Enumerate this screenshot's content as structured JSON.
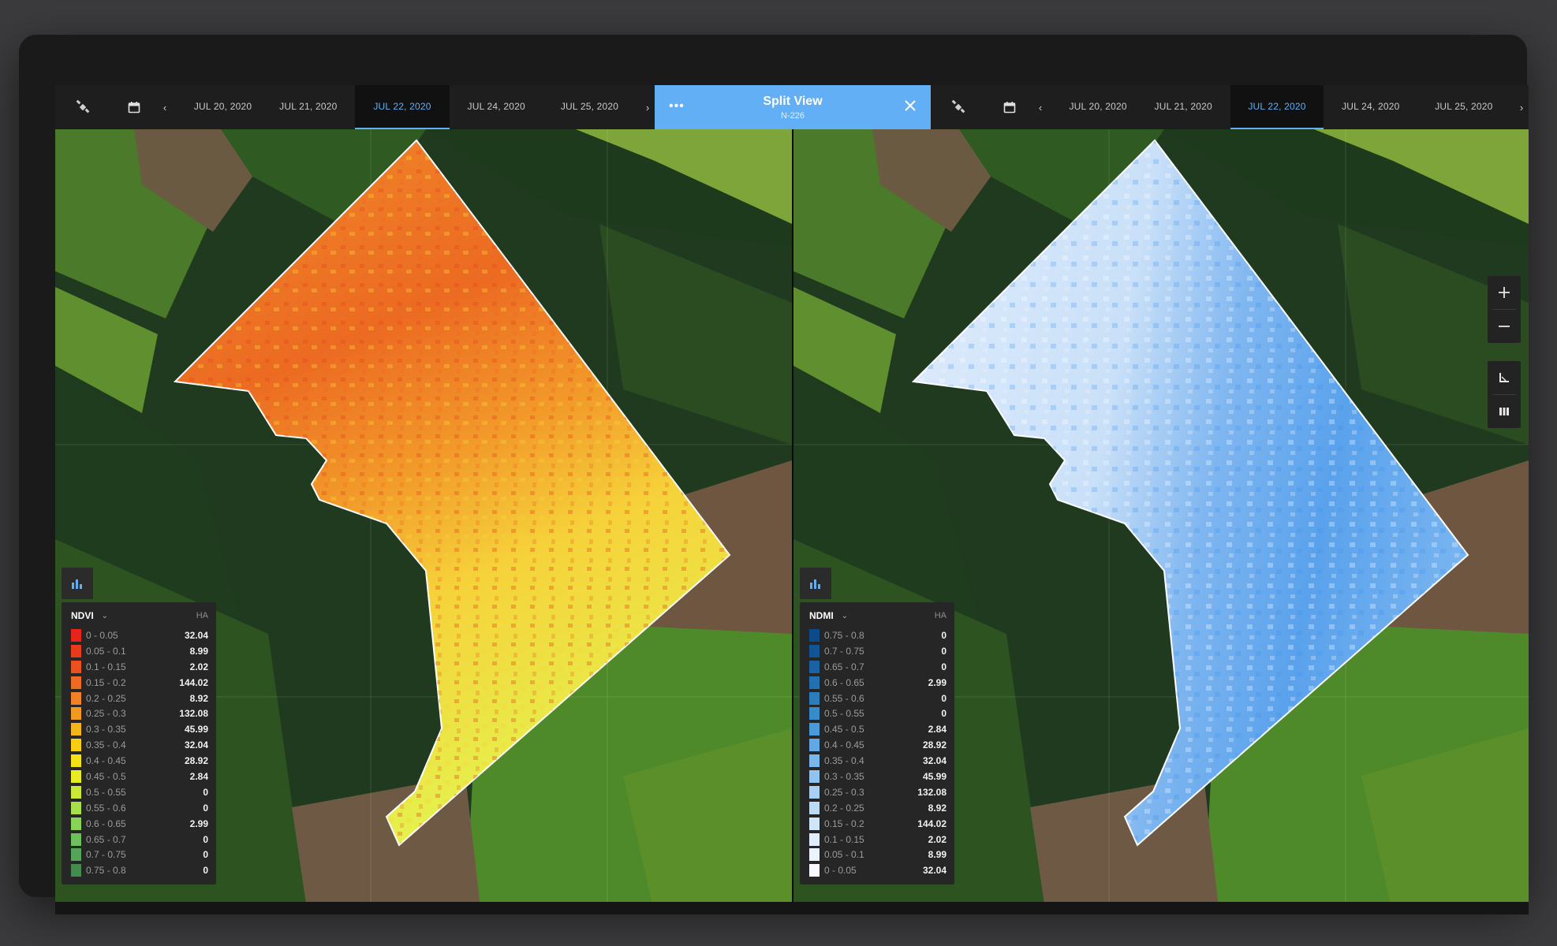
{
  "left_bar": {
    "icon": "satellite-icon",
    "calendar_icon": "calendar-icon",
    "dates": [
      {
        "label": "JUL 20, 2020",
        "active": false
      },
      {
        "label": "JUL 21, 2020",
        "active": false
      },
      {
        "label": "JUL 22, 2020",
        "active": true
      },
      {
        "label": "JUL 24, 2020",
        "active": false
      },
      {
        "label": "JUL 25, 2020",
        "active": false
      }
    ]
  },
  "split_view": {
    "menu_icon": "more-dots-icon",
    "title": "Split View",
    "subtitle": "N-226",
    "close_icon": "close-icon"
  },
  "right_bar": {
    "icon": "satellite-icon",
    "calendar_icon": "calendar-icon",
    "dates": [
      {
        "label": "JUL 20, 2020",
        "active": false
      },
      {
        "label": "JUL 21, 2020",
        "active": false
      },
      {
        "label": "JUL 22, 2020",
        "active": true
      },
      {
        "label": "JUL 24, 2020",
        "active": false
      },
      {
        "label": "JUL 25, 2020",
        "active": false
      }
    ]
  },
  "controls": {
    "zoom_in": "plus-icon",
    "zoom_out": "minus-icon",
    "measure": "ruler-icon",
    "layers": "layers-icon"
  },
  "ndvi_legend": {
    "name": "NDVI",
    "unit": "HA",
    "rows": [
      {
        "range": "0 - 0.05",
        "value": "32.04",
        "color": "#e8241a"
      },
      {
        "range": "0.05 - 0.1",
        "value": "8.99",
        "color": "#ea3a1c"
      },
      {
        "range": "0.1 - 0.15",
        "value": "2.02",
        "color": "#ec501f"
      },
      {
        "range": "0.15 - 0.2",
        "value": "144.02",
        "color": "#ee6a22"
      },
      {
        "range": "0.2 - 0.25",
        "value": "8.92",
        "color": "#f08125"
      },
      {
        "range": "0.25 - 0.3",
        "value": "132.08",
        "color": "#f29a1f"
      },
      {
        "range": "0.3 - 0.35",
        "value": "45.99",
        "color": "#f5b419"
      },
      {
        "range": "0.35 - 0.4",
        "value": "32.04",
        "color": "#f7ce12"
      },
      {
        "range": "0.4 - 0.45",
        "value": "28.92",
        "color": "#f5e216"
      },
      {
        "range": "0.45 - 0.5",
        "value": "2.84",
        "color": "#e7ec23"
      },
      {
        "range": "0.5 - 0.55",
        "value": "0",
        "color": "#c9e838"
      },
      {
        "range": "0.55 - 0.6",
        "value": "0",
        "color": "#a8e04a"
      },
      {
        "range": "0.6 - 0.65",
        "value": "2.99",
        "color": "#88d457"
      },
      {
        "range": "0.65 - 0.7",
        "value": "0",
        "color": "#6dc05c"
      },
      {
        "range": "0.7 - 0.75",
        "value": "0",
        "color": "#56a35a"
      },
      {
        "range": "0.75 - 0.8",
        "value": "0",
        "color": "#458a4f"
      }
    ]
  },
  "ndmi_legend": {
    "name": "NDMI",
    "unit": "HA",
    "rows": [
      {
        "range": "0.75 - 0.8",
        "value": "0",
        "color": "#0d4a8a"
      },
      {
        "range": "0.7 - 0.75",
        "value": "0",
        "color": "#125596"
      },
      {
        "range": "0.65 - 0.7",
        "value": "0",
        "color": "#1a62a3"
      },
      {
        "range": "0.6 - 0.65",
        "value": "2.99",
        "color": "#2270b0"
      },
      {
        "range": "0.55 - 0.6",
        "value": "0",
        "color": "#2b7ebd"
      },
      {
        "range": "0.5 - 0.55",
        "value": "0",
        "color": "#368ccb"
      },
      {
        "range": "0.45 - 0.5",
        "value": "2.84",
        "color": "#4a9ada"
      },
      {
        "range": "0.4 - 0.45",
        "value": "28.92",
        "color": "#62a8e4"
      },
      {
        "range": "0.35 - 0.4",
        "value": "32.04",
        "color": "#7ab6ea"
      },
      {
        "range": "0.3 - 0.35",
        "value": "45.99",
        "color": "#92c3ee"
      },
      {
        "range": "0.25 - 0.3",
        "value": "132.08",
        "color": "#a9cff2"
      },
      {
        "range": "0.2 - 0.25",
        "value": "8.92",
        "color": "#bddbf5"
      },
      {
        "range": "0.15 - 0.2",
        "value": "144.02",
        "color": "#cfe5f8"
      },
      {
        "range": "0.1 - 0.15",
        "value": "2.02",
        "color": "#dfeefa"
      },
      {
        "range": "0.05 - 0.1",
        "value": "8.99",
        "color": "#ebf4fc"
      },
      {
        "range": "0 - 0.05",
        "value": "32.04",
        "color": "#f6fafe"
      }
    ]
  }
}
